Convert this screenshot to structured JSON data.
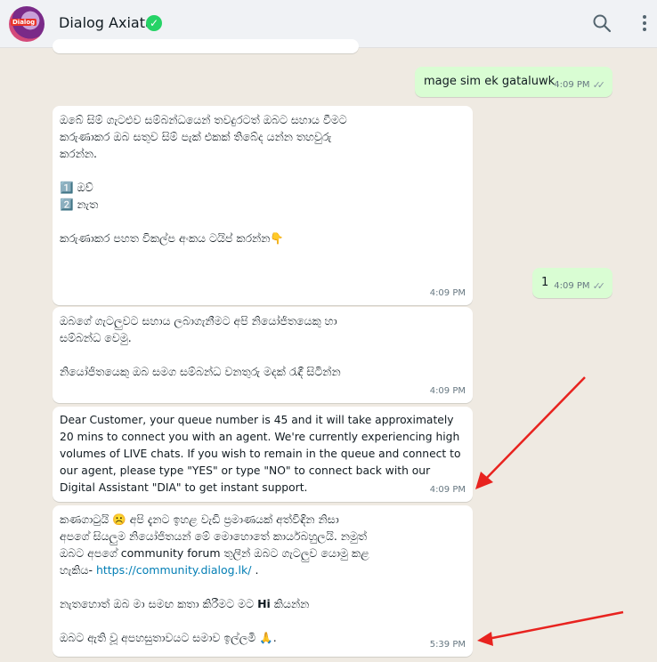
{
  "header": {
    "contact_name": "Dialog Axiata",
    "verified_icon": "check-badge-icon",
    "avatar_logo": "Dialog",
    "icons": [
      "search-icon",
      "menu-icon"
    ]
  },
  "messages": [
    {
      "direction": "out",
      "text": "mage sim ek gataluwk",
      "time": "4:09 PM"
    },
    {
      "direction": "in",
      "lines": [
        "ඔබේ සිම් ගැටළුව සම්බන්ධයෙන් තවදුරටත් ඔබට සහාය වීමට",
        "කරුණාකර ඔබ සතුව සිම් පැක් එකක් තිබේද යන්න තහවුරු",
        "කරන්න.",
        "",
        "1️⃣ ඔව්",
        "2️⃣ නැත",
        "",
        "කරුණාකර පහත විකල්ප අංකය ටයිප් කරන්න👇"
      ],
      "time": "4:09 PM"
    },
    {
      "direction": "out",
      "text": "1",
      "time": "4:09 PM"
    },
    {
      "direction": "in",
      "lines": [
        "ඔබගේ ගැටලුවට සහාය ලබාගැනීමට අපි නියෝජිතයෙකු හා",
        "සම්බන්ධ වෙමු.",
        "",
        "නියෝජිතයෙකු ඔබ සමග සම්බන්ධ වනතුරු මදක් රැඳී සිටින්න"
      ],
      "time": "4:09 PM"
    },
    {
      "direction": "in",
      "lines": [
        "Dear Customer, your queue number is 45 and it will take approximately",
        "20 mins to connect you with an agent. We're currently experiencing high",
        "volumes of LIVE chats. If you wish to remain in the queue and connect to",
        "our agent, please type \"YES\" or type \"NO\" to connect back with our",
        "Digital Assistant \"DIA\" to get instant support."
      ],
      "time": "4:09 PM"
    },
    {
      "direction": "in",
      "line1": "කණගාටුයි ☹️ අපි දැනට ඉහළ වැඩි ප්‍රමාණයක් අත්විඳින නිසා",
      "line2": "අපගේ සියලුම නියෝජිතයන් මේ මොහොතේ කාර්යබහුලයි. නමුත්",
      "line3": "ඔබට අපගේ community forum තුලින් ඔබට ගැටලුව යොමු කළ",
      "line4_prefix": "හැකිය- ",
      "link": "https://community.dialog.lk/",
      "line4_suffix": " .",
      "line5_prefix": "නැතහොත් ඔබ මා සමඟ කතා කිරීමට මට ",
      "line5_bold": "Hi",
      "line5_suffix": " කියන්න",
      "line6": "ඔබට ඇති වූ අපහසුතාවයට සමාව ඉල්ලමි 🙏.",
      "time": "5:39 PM"
    }
  ],
  "colors": {
    "chat_bg": "#efeae2",
    "incoming": "#ffffff",
    "outgoing": "#d9fdd3",
    "annotation_arrow": "#e8231f"
  }
}
